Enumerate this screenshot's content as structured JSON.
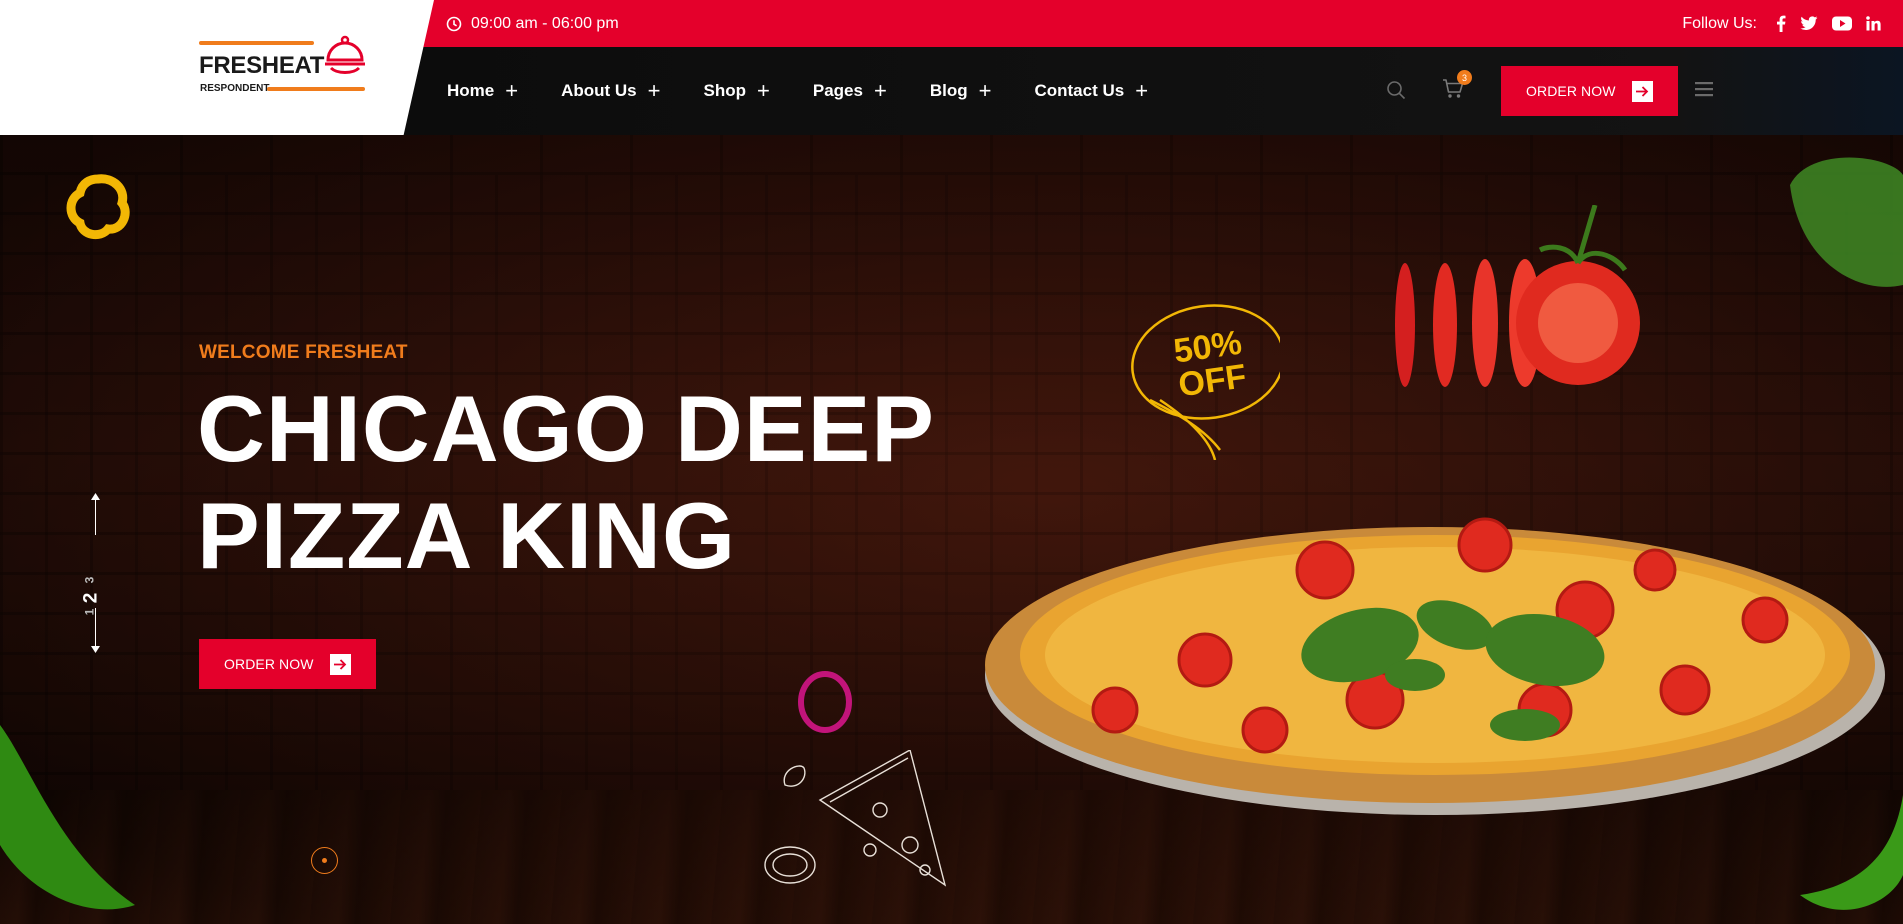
{
  "brand": {
    "name": "FRESHEAT",
    "tagline": "RESPONDENT"
  },
  "topbar": {
    "hours": "09:00 am - 06:00 pm",
    "follow_label": "Follow Us:",
    "social": [
      "facebook-icon",
      "twitter-icon",
      "youtube-icon",
      "linkedin-icon"
    ]
  },
  "nav": {
    "items": [
      {
        "label": "Home"
      },
      {
        "label": "About Us"
      },
      {
        "label": "Shop"
      },
      {
        "label": "Pages"
      },
      {
        "label": "Blog"
      },
      {
        "label": "Contact Us"
      }
    ],
    "cart_count": "3",
    "order_label": "ORDER NOW"
  },
  "hero": {
    "eyebrow": "WELCOME FRESHEAT",
    "title_line1": "CHICAGO DEEP",
    "title_line2": "PIZZA KING",
    "cta_label": "ORDER NOW",
    "badge_line1": "50%",
    "badge_line2": "OFF",
    "slides": [
      "1",
      "2",
      "3"
    ],
    "active_slide": "2"
  },
  "colors": {
    "primary": "#e4002b",
    "accent": "#f07c1c",
    "dark": "#111111"
  }
}
